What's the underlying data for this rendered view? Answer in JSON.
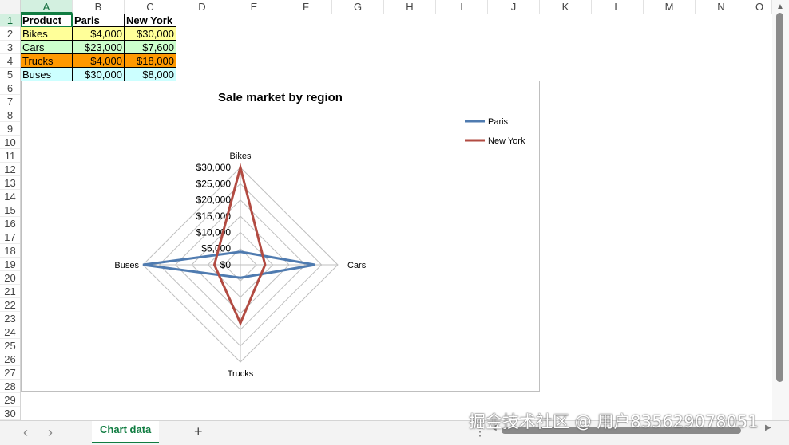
{
  "columns": [
    "A",
    "B",
    "C",
    "D",
    "E",
    "F",
    "G",
    "H",
    "I",
    "J",
    "K",
    "L",
    "M",
    "N",
    "O"
  ],
  "rows": [
    "1",
    "2",
    "3",
    "4",
    "5",
    "6",
    "7",
    "8",
    "9",
    "10",
    "11",
    "12",
    "13",
    "14",
    "15",
    "16",
    "17",
    "18",
    "19",
    "20",
    "21",
    "22",
    "23",
    "24",
    "25",
    "26",
    "27",
    "28",
    "29",
    "30"
  ],
  "table": {
    "headers": [
      "Product",
      "Paris",
      "New York"
    ],
    "rows": [
      {
        "product": "Bikes",
        "paris": "$4,000",
        "ny": "$30,000",
        "product_color": "#ffff99",
        "paris_color": "#ffff99",
        "ny_color": "#ffff99"
      },
      {
        "product": "Cars",
        "paris": "$23,000",
        "ny": "$7,600",
        "product_color": "#ccffcc",
        "paris_color": "#ccffcc",
        "ny_color": "#ccffcc"
      },
      {
        "product": "Trucks",
        "paris": "$4,000",
        "ny": "$18,000",
        "product_color": "#ff9900",
        "paris_color": "#ff9900",
        "ny_color": "#ff9900"
      },
      {
        "product": "Buses",
        "paris": "$30,000",
        "ny": "$8,000",
        "product_color": "#ccffff",
        "paris_color": "#ccffff",
        "ny_color": "#ccffff"
      }
    ]
  },
  "chart_data": {
    "type": "radar",
    "title": "Sale market by region",
    "categories": [
      "Bikes",
      "Cars",
      "Trucks",
      "Buses"
    ],
    "series": [
      {
        "name": "Paris",
        "values": [
          4000,
          23000,
          4000,
          30000
        ],
        "color": "#4f7bb0"
      },
      {
        "name": "New York",
        "values": [
          30000,
          7600,
          18000,
          8000
        ],
        "color": "#b24b42"
      }
    ],
    "ylim": [
      0,
      30000
    ],
    "ticks": [
      "$0",
      "$5,000",
      "$10,000",
      "$15,000",
      "$20,000",
      "$25,000",
      "$30,000"
    ],
    "legend": "top-right"
  },
  "tabs": {
    "active": "Chart data",
    "add": "+",
    "more": "⋮"
  },
  "nav": {
    "prev": "‹",
    "next": "›"
  },
  "watermark": "掘金技术社区 @ 用户835629078051"
}
